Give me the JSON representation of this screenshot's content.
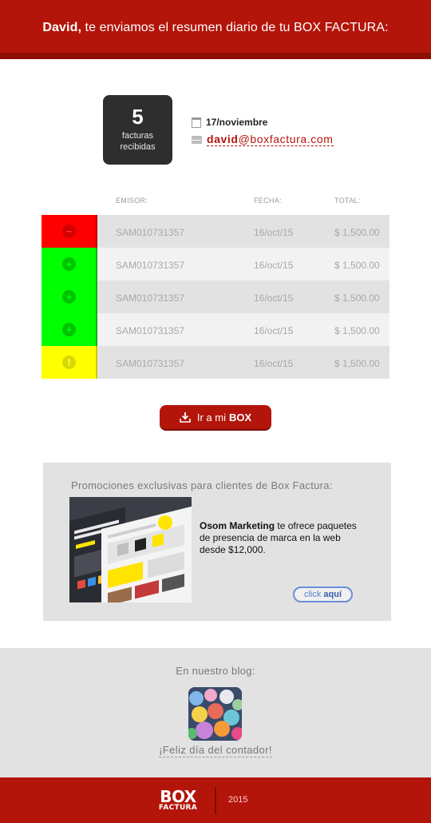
{
  "header": {
    "name": "David,",
    "message": " te enviamos el resumen diario de tu BOX FACTURA:"
  },
  "summary": {
    "count": "5",
    "count_label_1": "facturas",
    "count_label_2": "recibidas",
    "date": "17/noviembre",
    "email_user": "david",
    "email_domain": "@boxfactura.com"
  },
  "table": {
    "headers": {
      "emisor": "EMISOR:",
      "fecha": "FECHA:",
      "total": "TOTAL:"
    },
    "rows": [
      {
        "status": "red",
        "emisor": "SAM010731357",
        "fecha": "16/oct/15",
        "total": "$ 1,500.00"
      },
      {
        "status": "green",
        "emisor": "SAM010731357",
        "fecha": "16/oct/15",
        "total": "$ 1,500.00"
      },
      {
        "status": "green",
        "emisor": "SAM010731357",
        "fecha": "16/oct/15",
        "total": "$ 1,500.00"
      },
      {
        "status": "green",
        "emisor": "SAM010731357",
        "fecha": "16/oct/15",
        "total": "$ 1,500.00"
      },
      {
        "status": "yellow",
        "emisor": "SAM010731357",
        "fecha": "16/oct/15",
        "total": "$ 1,500.00"
      }
    ]
  },
  "cta": {
    "prefix": "Ir a mi",
    "bold": "BOX",
    "icon": "download-icon"
  },
  "promo": {
    "title": "Promociones exclusivas para clientes de Box Factura:",
    "brand": "Osom Marketing",
    "text": " te ofrece paquetes de presencia de marca en la web desde $12,000.",
    "link_prefix": "click ",
    "link_bold": "aquí"
  },
  "blog": {
    "title": "En nuestro blog:",
    "link": "¡Feliz día del contador!"
  },
  "footer": {
    "logo_line1": "BOX",
    "logo_line2": "FACTURA",
    "year": "2015"
  },
  "colors": {
    "brand_red": "#b3150b",
    "status_red": "#ff0000",
    "status_green": "#00ff00",
    "status_yellow": "#ffff00"
  }
}
